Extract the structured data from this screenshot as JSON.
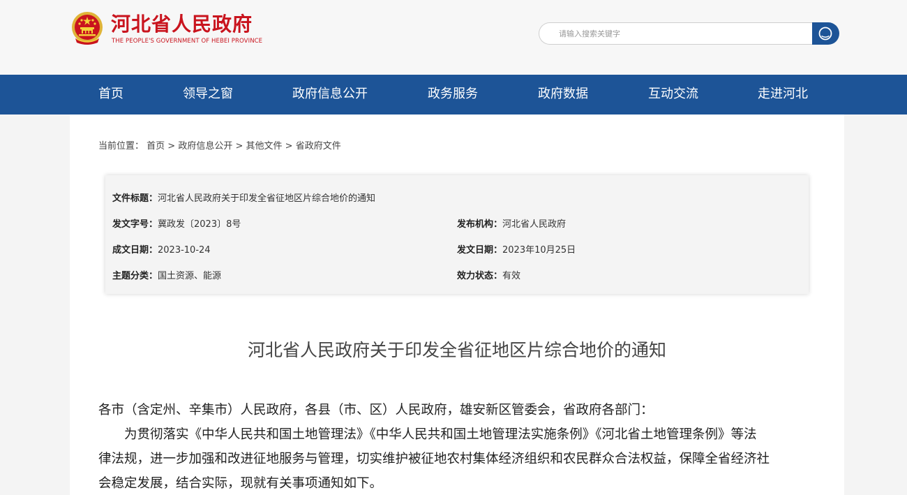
{
  "header": {
    "site_title": "河北省人民政府",
    "site_subtitle": "THE PEOPLE'S GOVERNMENT OF HEBEI PROVINCE",
    "search_placeholder": "请输入搜索关键字",
    "brand_color": "#c9141e",
    "nav_color": "#1d5497"
  },
  "nav": {
    "items": [
      "首页",
      "领导之窗",
      "政府信息公开",
      "政务服务",
      "政府数据",
      "互动交流",
      "走进河北"
    ]
  },
  "breadcrumb": {
    "prefix": "当前位置：",
    "crumbs": [
      "首页",
      "政府信息公开",
      "其他文件",
      "省政府文件"
    ],
    "separator": " > "
  },
  "meta": {
    "title_label": "文件标题：",
    "title_value": "河北省人民政府关于印发全省征地区片综合地价的通知",
    "docno_label": "发文字号：",
    "docno_value": "冀政发〔2023〕8号",
    "issuer_label": "发布机构：",
    "issuer_value": "河北省人民政府",
    "created_label": "成文日期：",
    "created_value": "2023-10-24",
    "published_label": "发文日期：",
    "published_value": "2023年10月25日",
    "topic_label": "主题分类：",
    "topic_value": "国土资源、能源",
    "status_label": "效力状态：",
    "status_value": "有效"
  },
  "document": {
    "title": "河北省人民政府关于印发全省征地区片综合地价的通知",
    "addressee": "各市（含定州、辛集市）人民政府，各县（市、区）人民政府，雄安新区管委会，省政府各部门：",
    "body_line1": "为贯彻落实《中华人民共和国土地管理法》《中华人民共和国土地管理法实施条例》《河北省土地管理条例》等法",
    "body_line2": "律法规，进一步加强和改进征地服务与管理，切实维护被征地农村集体经济组织和农民群众合法权益，保障全省经济社",
    "body_line3": "会稳定发展，结合实际，现就有关事项通知如下。"
  }
}
